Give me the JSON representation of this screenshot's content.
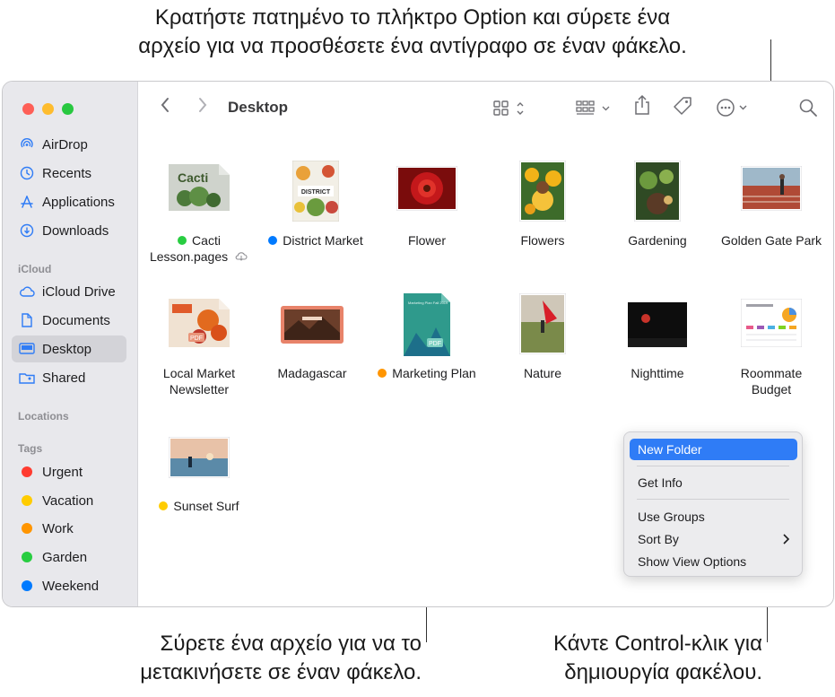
{
  "callouts": {
    "top_line1": "Κρατήστε πατημένο το πλήκτρο Option και σύρετε ένα",
    "top_line2": "αρχείο για να προσθέσετε ένα αντίγραφο σε έναν φάκελο.",
    "bottom_left_line1": "Σύρετε ένα αρχείο για να το",
    "bottom_left_line2": "μετακινήσετε σε έναν φάκελο.",
    "bottom_right_line1": "Κάντε Control-κλικ για",
    "bottom_right_line2": "δημιουργία φακέλου."
  },
  "window": {
    "title": "Desktop"
  },
  "sidebar": {
    "favorites": [
      {
        "label": "AirDrop",
        "icon": "airdrop-icon"
      },
      {
        "label": "Recents",
        "icon": "clock-icon"
      },
      {
        "label": "Applications",
        "icon": "applications-icon"
      },
      {
        "label": "Downloads",
        "icon": "download-icon"
      }
    ],
    "icloud_heading": "iCloud",
    "icloud": [
      {
        "label": "iCloud Drive",
        "icon": "cloud-icon"
      },
      {
        "label": "Documents",
        "icon": "document-icon"
      },
      {
        "label": "Desktop",
        "icon": "desktop-icon",
        "selected": true
      },
      {
        "label": "Shared",
        "icon": "shared-folder-icon"
      }
    ],
    "locations_heading": "Locations",
    "tags_heading": "Tags",
    "tags": [
      {
        "label": "Urgent",
        "color": "#ff3b30"
      },
      {
        "label": "Vacation",
        "color": "#ffcc00"
      },
      {
        "label": "Work",
        "color": "#ff9500"
      },
      {
        "label": "Garden",
        "color": "#28cd41"
      },
      {
        "label": "Weekend",
        "color": "#007aff"
      }
    ]
  },
  "toolbar": {
    "back": "back-chevron-icon",
    "forward": "forward-chevron-icon",
    "view_toggle": "grid-view-icon",
    "group": "group-icon",
    "share": "share-icon",
    "tag": "tag-icon",
    "more": "more-icon",
    "search": "search-icon"
  },
  "files": [
    {
      "name_line1": "Cacti",
      "name_line2": "Lesson.pages",
      "tag_color": "#28cd41",
      "cloud": true
    },
    {
      "name_line1": "District Market",
      "name_line2": "",
      "tag_color": "#007aff"
    },
    {
      "name_line1": "Flower",
      "name_line2": ""
    },
    {
      "name_line1": "Flowers",
      "name_line2": ""
    },
    {
      "name_line1": "Gardening",
      "name_line2": ""
    },
    {
      "name_line1": "Golden Gate Park",
      "name_line2": ""
    },
    {
      "name_line1": "Local Market",
      "name_line2": "Newsletter"
    },
    {
      "name_line1": "Madagascar",
      "name_line2": ""
    },
    {
      "name_line1": "Marketing Plan",
      "name_line2": "",
      "tag_color": "#ff9500"
    },
    {
      "name_line1": "Nature",
      "name_line2": ""
    },
    {
      "name_line1": "Nighttime",
      "name_line2": ""
    },
    {
      "name_line1": "Roommate",
      "name_line2": "Budget"
    },
    {
      "name_line1": "Sunset Surf",
      "name_line2": "",
      "tag_color": "#ffcc00"
    }
  ],
  "thumb_text": {
    "cacti": "Cacti",
    "district": "DISTRICT",
    "marketing": "Marketing Plan Fall 2019",
    "pdf": "PDF"
  },
  "context_menu": {
    "items": [
      "New Folder",
      "Get Info",
      "Use Groups",
      "Sort By",
      "Show View Options"
    ],
    "highlighted": "New Folder"
  }
}
